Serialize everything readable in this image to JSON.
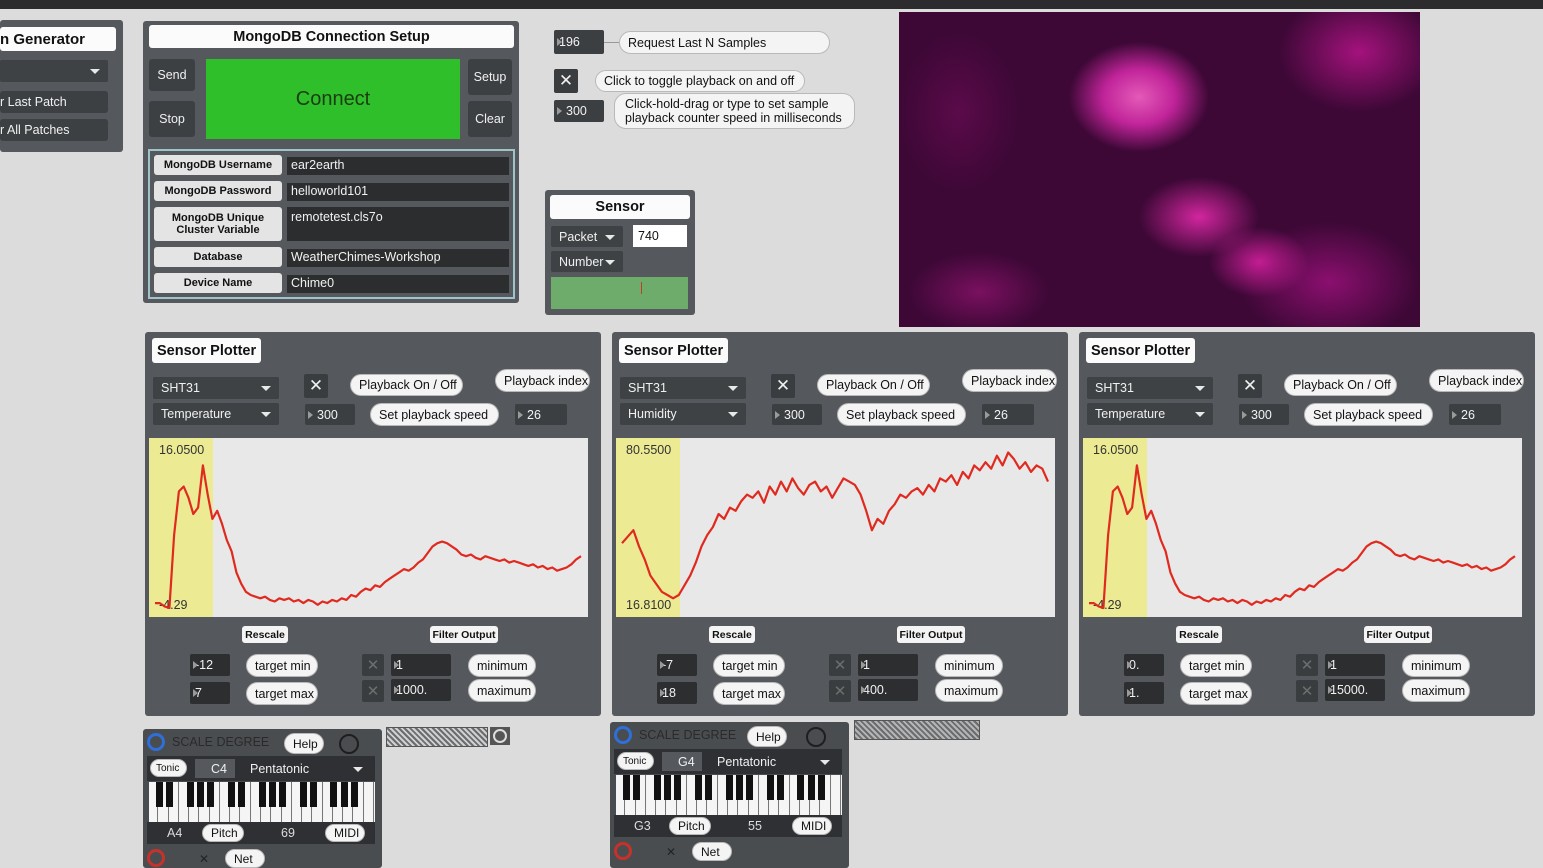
{
  "generator": {
    "title": "n Generator",
    "recall_last": "r Last Patch",
    "recall_all": "r All Patches"
  },
  "mongodb": {
    "title": "MongoDB Connection Setup",
    "send": "Send",
    "stop": "Stop",
    "connect": "Connect",
    "setup": "Setup",
    "clear": "Clear",
    "fields": [
      {
        "label": "MongoDB Username",
        "value": "ear2earth"
      },
      {
        "label": "MongoDB Password",
        "value": "helloworld101"
      },
      {
        "label": "MongoDB Unique Cluster Variable",
        "value": "remotetest.cls7o"
      },
      {
        "label": "Database",
        "value": "WeatherChimes-Workshop"
      },
      {
        "label": "Device Name",
        "value": "Chime0"
      }
    ]
  },
  "controls": {
    "samples_value": "196",
    "samples_label": "Request Last N Samples",
    "toggle_label": "Click to toggle playback on and off",
    "speed_value": "300",
    "speed_label_1": "Click-hold-drag or type to set sample",
    "speed_label_2": "playback counter speed in milliseconds"
  },
  "sensor": {
    "title": "Sensor",
    "packet": "Packet",
    "number": "Number",
    "value": "740"
  },
  "plotters": [
    {
      "title": "Sensor Plotter",
      "sensor": "SHT31",
      "measure": "Temperature",
      "playback_toggle": "Playback On / Off",
      "playback_index_label": "Playback index",
      "speed": "300",
      "speed_label": "Set playback speed",
      "index": "26",
      "ymax": "16.0500",
      "ymin": "-4.29",
      "rescale": "Rescale",
      "filter": "Filter Output",
      "tmin": "-12",
      "tmin_label": "target min",
      "tmax": "7",
      "tmax_label": "target max",
      "fmin": "1",
      "fmin_label": "minimum",
      "fmax": "1000.",
      "fmax_label": "maximum",
      "series": [
        3,
        3,
        1,
        0,
        45,
        72,
        75,
        68,
        58,
        62,
        88,
        70,
        55,
        60,
        52,
        42,
        35,
        22,
        15,
        10,
        8,
        7,
        6,
        7,
        5,
        4,
        6,
        5,
        6,
        4,
        5,
        3,
        5,
        4,
        2,
        4,
        3,
        5,
        4,
        6,
        5,
        8,
        7,
        10,
        12,
        11,
        14,
        13,
        16,
        18,
        20,
        22,
        24,
        23,
        25,
        28,
        30,
        34,
        38,
        40,
        41,
        40,
        38,
        36,
        33,
        32,
        33,
        31,
        30,
        32,
        31,
        30,
        29,
        30,
        28,
        29,
        28,
        27,
        26,
        27,
        25,
        26,
        24,
        25,
        23,
        24,
        25,
        27,
        30,
        32
      ]
    },
    {
      "title": "Sensor Plotter",
      "sensor": "SHT31",
      "measure": "Humidity",
      "playback_toggle": "Playback On / Off",
      "playback_index_label": "Playback index",
      "speed": "300",
      "speed_label": "Set playback speed",
      "index": "26",
      "ymax": "80.5500",
      "ymin": "16.8100",
      "rescale": "Rescale",
      "filter": "Filter Output",
      "tmin": "-7",
      "tmin_label": "target min",
      "tmax": "18",
      "tmax_label": "target max",
      "fmin": "1",
      "fmin_label": "minimum",
      "fmax": "400.",
      "fmax_label": "maximum",
      "series": [
        40,
        44,
        48,
        38,
        30,
        20,
        15,
        10,
        8,
        6,
        8,
        14,
        20,
        28,
        38,
        45,
        50,
        58,
        55,
        62,
        60,
        66,
        70,
        68,
        72,
        65,
        75,
        70,
        78,
        72,
        80,
        74,
        70,
        76,
        78,
        72,
        75,
        68,
        74,
        80,
        78,
        76,
        70,
        60,
        48,
        55,
        52,
        60,
        64,
        70,
        68,
        72,
        74,
        70,
        76,
        72,
        80,
        78,
        82,
        76,
        84,
        80,
        88,
        85,
        90,
        86,
        94,
        88,
        96,
        92,
        86,
        90,
        84,
        88,
        86,
        78
      ]
    },
    {
      "title": "Sensor Plotter",
      "sensor": "SHT31",
      "measure": "Temperature",
      "playback_toggle": "Playback On / Off",
      "playback_index_label": "Playback index",
      "speed": "300",
      "speed_label": "Set playback speed",
      "index": "26",
      "ymax": "16.0500",
      "ymin": "-4.29",
      "rescale": "Rescale",
      "filter": "Filter Output",
      "tmin": "0.",
      "tmin_label": "target min",
      "tmax": "1.",
      "tmax_label": "target max",
      "fmin": "1",
      "fmin_label": "minimum",
      "fmax": "15000.",
      "fmax_label": "maximum",
      "series": [
        3,
        3,
        1,
        0,
        45,
        72,
        75,
        68,
        58,
        62,
        88,
        70,
        55,
        60,
        52,
        42,
        35,
        22,
        15,
        10,
        8,
        7,
        6,
        7,
        5,
        4,
        6,
        5,
        6,
        4,
        5,
        3,
        5,
        4,
        2,
        4,
        3,
        5,
        4,
        6,
        5,
        8,
        7,
        10,
        12,
        11,
        14,
        13,
        16,
        18,
        20,
        22,
        24,
        23,
        25,
        28,
        30,
        34,
        38,
        40,
        41,
        40,
        38,
        36,
        33,
        32,
        33,
        31,
        30,
        32,
        31,
        30,
        29,
        30,
        28,
        29,
        28,
        27,
        26,
        27,
        25,
        26,
        24,
        25,
        23,
        24,
        25,
        27,
        30,
        32
      ]
    }
  ],
  "scale_modules": [
    {
      "label": "SCALE DEGREE",
      "help": "Help",
      "tonic": "Tonic",
      "note": "C4",
      "scale": "Pentatonic",
      "pitch_note": "A4",
      "pitch": "Pitch",
      "midi_value": "69",
      "midi": "MIDI",
      "net": "Net"
    },
    {
      "label": "SCALE DEGREE",
      "help": "Help",
      "tonic": "Tonic",
      "note": "G4",
      "scale": "Pentatonic",
      "pitch_note": "G3",
      "pitch": "Pitch",
      "midi_value": "55",
      "midi": "MIDI",
      "net": "Net"
    }
  ],
  "colors": {
    "connect": "#2fbf2a",
    "plot_line": "#e02a1f",
    "highlight": "#eceb94",
    "panel": "#55585c"
  }
}
